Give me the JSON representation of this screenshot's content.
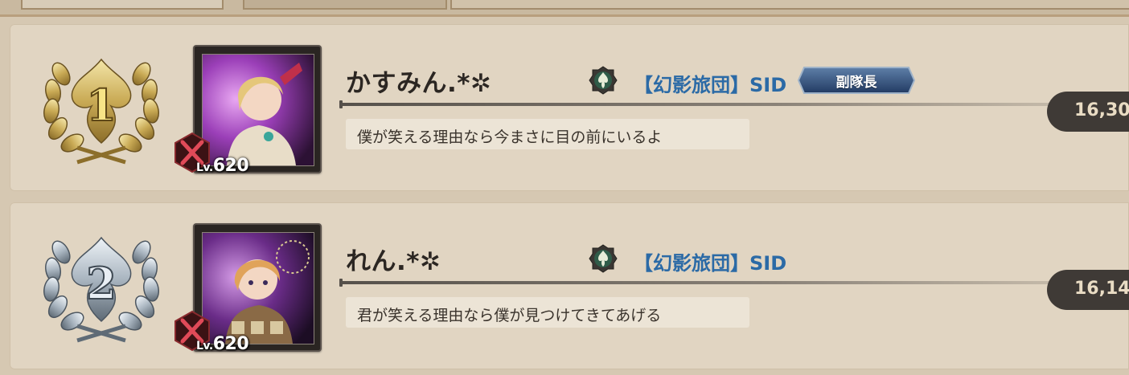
{
  "rankings": [
    {
      "rank": "1",
      "player_name": "かすみん.*✲",
      "level_prefix": "Lv.",
      "level": "620",
      "guild_name": "【幻影旅団】SID",
      "role": "副隊長",
      "comment": "僕が笑える理由なら今まさに目の前にいるよ",
      "score": "16,30",
      "emblem_color": "#d8c27a",
      "portrait_accent": "#b05ad0"
    },
    {
      "rank": "2",
      "player_name": "れん.*✲",
      "level_prefix": "Lv.",
      "level": "620",
      "guild_name": "【幻影旅団】SID",
      "role": "",
      "comment": "君が笑える理由なら僕が見つけてきてあげる",
      "score": "16,14",
      "emblem_color": "#b7c2cc",
      "portrait_accent": "#8e55b8"
    }
  ],
  "icons": {
    "rank_emblem": "laurel-wreath-icon",
    "guild_emblem": "fleur-de-lis-icon",
    "class_badge": "crossed-swords-icon"
  }
}
